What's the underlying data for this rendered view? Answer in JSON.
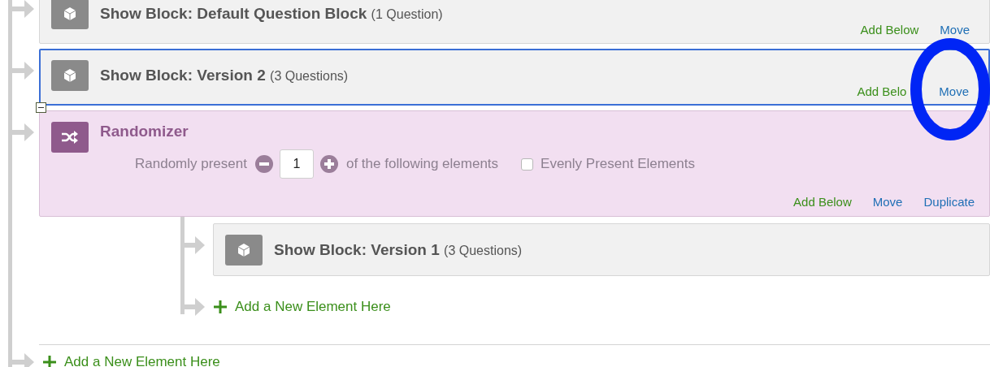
{
  "blocks": [
    {
      "kind": "block",
      "title": "Show Block: Default Question Block",
      "count": "(1 Question)",
      "selected": false,
      "actions": [
        {
          "kind": "add",
          "label": "Add Below"
        },
        {
          "kind": "move",
          "label": "Move"
        }
      ]
    },
    {
      "kind": "block",
      "title": "Show Block: Version 2",
      "count": "(3 Questions)",
      "selected": true,
      "actions": [
        {
          "kind": "add",
          "label": "Add Belo"
        },
        {
          "kind": "move",
          "label": "Move"
        }
      ]
    },
    {
      "kind": "randomizer",
      "title": "Randomizer",
      "expanded": true,
      "present_prefix": "Randomly present",
      "present_count": "1",
      "present_suffix": "of the following elements",
      "evenly": {
        "label": "Evenly Present Elements",
        "checked": false
      },
      "actions": [
        {
          "kind": "add",
          "label": "Add Below"
        },
        {
          "kind": "move",
          "label": "Move"
        },
        {
          "kind": "duplicate",
          "label": "Duplicate"
        }
      ],
      "children": [
        {
          "kind": "block",
          "title": "Show Block: Version 1",
          "count": "(3 Questions)",
          "selected": false
        }
      ],
      "add_element": "Add a New Element Here"
    }
  ],
  "add_element": "Add a New Element Here"
}
